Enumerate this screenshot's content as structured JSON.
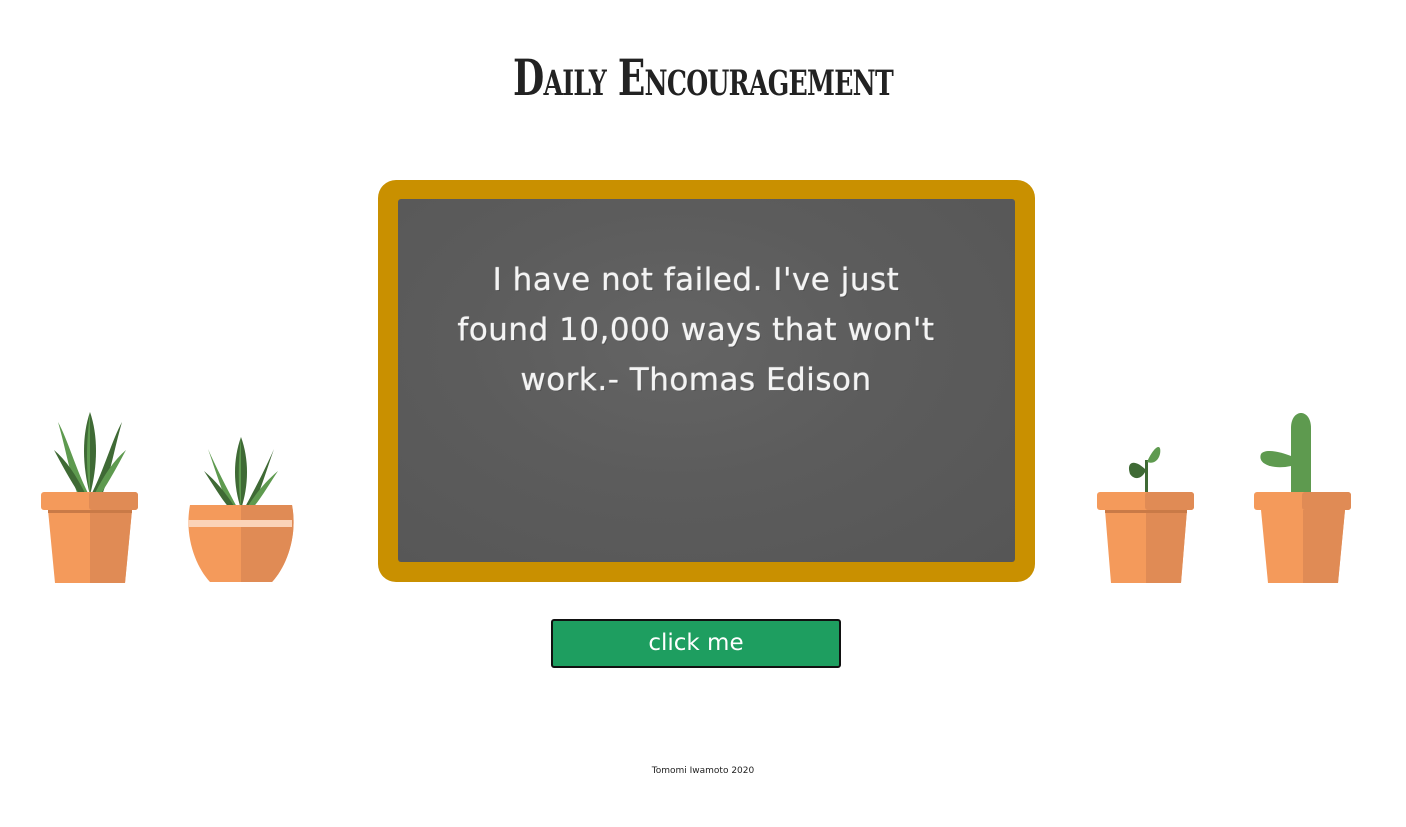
{
  "page": {
    "title": "Daily Encouragement",
    "footer": "Tomomi Iwamoto 2020"
  },
  "chalkboard": {
    "quote": "I have not failed. I've just found 10,000 ways that won't work.- Thomas Edison"
  },
  "button": {
    "label": "click me"
  },
  "colors": {
    "frame": "#c99000",
    "board": "#5a5a5a",
    "button": "#1e9e60",
    "pot": "#f49a5b",
    "pot_shade": "#e08b55",
    "leaf_dark": "#3f6a35",
    "leaf_light": "#5e9a4f"
  },
  "icons": [
    "plant-icon",
    "potted-snake-plant-icon",
    "round-pot-plant-icon",
    "seedling-pot-icon",
    "cactus-pot-icon"
  ]
}
